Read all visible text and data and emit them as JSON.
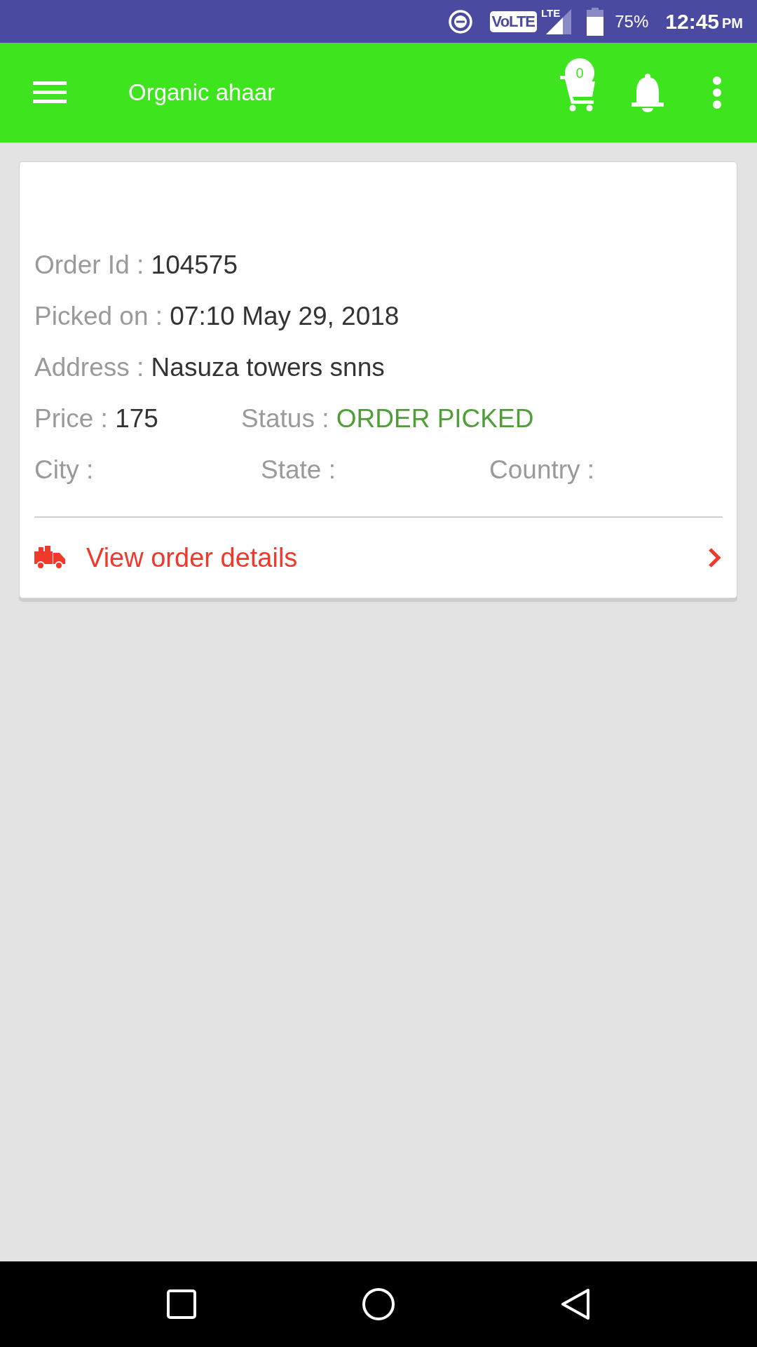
{
  "status_bar": {
    "network": "VoLTE",
    "data": "LTE",
    "battery": "75%",
    "time": "12:45",
    "period": "PM"
  },
  "app_bar": {
    "title": "Organic ahaar",
    "cart_count": "0"
  },
  "order": {
    "rows": [
      [
        {
          "label": "Order Id :",
          "value": "104575",
          "kind": "text"
        }
      ],
      [
        {
          "label": "Picked on :",
          "value": "07:10 May 29, 2018",
          "kind": "text"
        }
      ],
      [
        {
          "label": "Address :",
          "value": "Nasuza towers snns",
          "kind": "text"
        }
      ],
      [
        {
          "label": "Price :",
          "value": "175",
          "kind": "text"
        },
        {
          "label": "Status :",
          "value": "ORDER PICKED",
          "kind": "status"
        }
      ],
      [
        {
          "label": "City :"
        },
        {
          "label": "State :"
        },
        {
          "label": "Country :"
        }
      ]
    ],
    "link": "View order details"
  }
}
